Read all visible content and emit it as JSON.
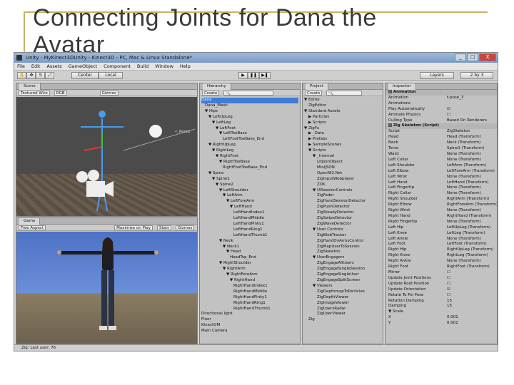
{
  "slide": {
    "title": "Connecting Joints for Dana the Avatar"
  },
  "window": {
    "title": "Unity - MyKinect3DUnity - Kinect3D - PC, Mac & Linux Standalone*",
    "buttons": [
      "_",
      "□",
      "X"
    ]
  },
  "menu": [
    "File",
    "Edit",
    "Assets",
    "GameObject",
    "Component",
    "Build",
    "Window",
    "Help"
  ],
  "toolbar": {
    "pivot": "Center",
    "space": "Local",
    "layers": "Layers",
    "layout": "2 by 3"
  },
  "scene": {
    "tab": "Scene",
    "mode": "Textured Wire",
    "render": "RGB",
    "gizmos": "Gizmos",
    "persp": "< Persp"
  },
  "game": {
    "tab": "Game",
    "aspect": "Free Aspect",
    "maximize": "Maximize on Play",
    "stats": "Stats",
    "gizmos": "Gizmos"
  },
  "hierarchy": {
    "tab": "Hierarchy",
    "create": "Create",
    "items": [
      {
        "label": "Dana",
        "depth": 0,
        "selected": true
      },
      {
        "label": "Dana_Mesh",
        "depth": 1
      },
      {
        "label": "▼ Hips",
        "depth": 1
      },
      {
        "label": "▼ LeftUpLeg",
        "depth": 2
      },
      {
        "label": "▼ LeftLeg",
        "depth": 3
      },
      {
        "label": "▼ LeftFoot",
        "depth": 4
      },
      {
        "label": "▼ LeftToeBase",
        "depth": 5
      },
      {
        "label": "LeftFootToeBase_End",
        "depth": 6
      },
      {
        "label": "▼ RightUpLeg",
        "depth": 2
      },
      {
        "label": "▼ RightLeg",
        "depth": 3
      },
      {
        "label": "▼ RightFoot",
        "depth": 4
      },
      {
        "label": "▼ RightToeBase",
        "depth": 5
      },
      {
        "label": "RightFootToeBase_End",
        "depth": 6
      },
      {
        "label": "▼ Spine",
        "depth": 2
      },
      {
        "label": "▼ Spine1",
        "depth": 3
      },
      {
        "label": "▼ Spine2",
        "depth": 4
      },
      {
        "label": "▼ LeftShoulder",
        "depth": 5
      },
      {
        "label": "▼ LeftArm",
        "depth": 6
      },
      {
        "label": "▼ LeftForeArm",
        "depth": 7
      },
      {
        "label": "▼ LeftHand",
        "depth": 8
      },
      {
        "label": "LeftHandIndex1",
        "depth": 9
      },
      {
        "label": "LeftHandMiddle",
        "depth": 9
      },
      {
        "label": "LeftHandPinky1",
        "depth": 9
      },
      {
        "label": "LeftHandRing1",
        "depth": 9
      },
      {
        "label": "LeftHandThumb1",
        "depth": 9
      },
      {
        "label": "▼ Neck",
        "depth": 5
      },
      {
        "label": "▼ Neck1",
        "depth": 6
      },
      {
        "label": "▼ Head",
        "depth": 7
      },
      {
        "label": "HeadTop_End",
        "depth": 8
      },
      {
        "label": "▼ RightShoulder",
        "depth": 5
      },
      {
        "label": "▼ RightArm",
        "depth": 6
      },
      {
        "label": "▼ RightForeArm",
        "depth": 7
      },
      {
        "label": "▼ RightHand",
        "depth": 8
      },
      {
        "label": "RightHandIndex1",
        "depth": 9
      },
      {
        "label": "RightHandMiddle",
        "depth": 9
      },
      {
        "label": "RightHandPinky1",
        "depth": 9
      },
      {
        "label": "RightHandRing1",
        "depth": 9
      },
      {
        "label": "RightHandThumb1",
        "depth": 9
      },
      {
        "label": "Directional light",
        "depth": 0
      },
      {
        "label": "Floor",
        "depth": 0
      },
      {
        "label": "KinectOM",
        "depth": 0
      },
      {
        "label": "Main Camera",
        "depth": 0
      }
    ]
  },
  "project": {
    "tab": "Project",
    "create": "Create",
    "items": [
      {
        "label": "▼ Editor",
        "depth": 0
      },
      {
        "label": "ZigEditor",
        "depth": 1
      },
      {
        "label": "▼ Standard Assets",
        "depth": 0
      },
      {
        "label": "▶ Particles",
        "depth": 1
      },
      {
        "label": "▶ Scripts",
        "depth": 1
      },
      {
        "label": "▼ ZigFu",
        "depth": 0
      },
      {
        "label": "▶ _Data",
        "depth": 1
      },
      {
        "label": "▶ Prefabs",
        "depth": 1
      },
      {
        "label": "▶ SampleScenes",
        "depth": 1
      },
      {
        "label": "▼ Scripts",
        "depth": 1
      },
      {
        "label": "▼ _Internal",
        "depth": 2
      },
      {
        "label": "LitJsonObject",
        "depth": 3
      },
      {
        "label": "MiniJSON",
        "depth": 3
      },
      {
        "label": "OpenNI2.Net",
        "depth": 3
      },
      {
        "label": "ZigInputWebplayer",
        "depth": 3
      },
      {
        "label": "ZDK",
        "depth": 3
      },
      {
        "label": "▼ UISessionControls",
        "depth": 2
      },
      {
        "label": "ZigFader",
        "depth": 3
      },
      {
        "label": "ZigHandSessionDetector",
        "depth": 3
      },
      {
        "label": "ZigPushDetector",
        "depth": 3
      },
      {
        "label": "ZigSteadyDetector",
        "depth": 3
      },
      {
        "label": "ZigSwipeDetector",
        "depth": 3
      },
      {
        "label": "ZigWaveDetector",
        "depth": 3
      },
      {
        "label": "▼ User Controls",
        "depth": 2
      },
      {
        "label": "ZigBlobTracker",
        "depth": 3
      },
      {
        "label": "ZigHandOnArmsControl",
        "depth": 3
      },
      {
        "label": "ZigMapUserToSession",
        "depth": 3
      },
      {
        "label": "ZigSkeleton",
        "depth": 3
      },
      {
        "label": "▼ UserEngagers",
        "depth": 2
      },
      {
        "label": "ZigEngageAllUsers",
        "depth": 3
      },
      {
        "label": "ZigEngageSingleSession",
        "depth": 3
      },
      {
        "label": "ZigEngageSingleUser",
        "depth": 3
      },
      {
        "label": "ZigEngageSplitScreen",
        "depth": 3
      },
      {
        "label": "▼ Viewers",
        "depth": 2
      },
      {
        "label": "ZigDepthmapToParticles",
        "depth": 3
      },
      {
        "label": "ZigDepthViewer",
        "depth": 3
      },
      {
        "label": "ZigImageViewer",
        "depth": 3
      },
      {
        "label": "ZigUsersRadar",
        "depth": 3
      },
      {
        "label": "ZigUserViewer",
        "depth": 3
      },
      {
        "label": "Zig",
        "depth": 1
      }
    ]
  },
  "inspector": {
    "tab": "Inspector",
    "animation": {
      "header": "Animation",
      "rows": [
        {
          "k": "Animation",
          "v": "t-pose_3"
        },
        {
          "k": "Animations",
          "v": ""
        },
        {
          "k": "Play Automatically",
          "v": "☑"
        },
        {
          "k": "Animate Physics",
          "v": "☐"
        },
        {
          "k": "Culling Type",
          "v": "Based On Renderers"
        }
      ]
    },
    "skeleton": {
      "header": "Zig Skeleton (Script)",
      "rows": [
        {
          "k": "Script",
          "v": "ZigSkeleton"
        },
        {
          "k": "Head",
          "v": "Head (Transform)"
        },
        {
          "k": "Neck",
          "v": "Neck (Transform)"
        },
        {
          "k": "Torso",
          "v": "Spine1 (Transform)"
        },
        {
          "k": "Waist",
          "v": "None (Transform)"
        },
        {
          "k": "Left Collar",
          "v": "None (Transform)"
        },
        {
          "k": "Left Shoulder",
          "v": "LeftArm (Transform)"
        },
        {
          "k": "Left Elbow",
          "v": "LeftForeArm (Transform)"
        },
        {
          "k": "Left Wrist",
          "v": "None (Transform)"
        },
        {
          "k": "Left Hand",
          "v": "LeftHand (Transform)"
        },
        {
          "k": "Left Fingertip",
          "v": "None (Transform)"
        },
        {
          "k": "Right Collar",
          "v": "None (Transform)"
        },
        {
          "k": "Right Shoulder",
          "v": "RightArm (Transform)"
        },
        {
          "k": "Right Elbow",
          "v": "RightForeArm (Transform)"
        },
        {
          "k": "Right Wrist",
          "v": "None (Transform)"
        },
        {
          "k": "Right Hand",
          "v": "RightHand (Transform)"
        },
        {
          "k": "Right Fingertip",
          "v": "None (Transform)"
        },
        {
          "k": "Left Hip",
          "v": "LeftUpLeg (Transform)"
        },
        {
          "k": "Left Knee",
          "v": "LeftLeg (Transform)"
        },
        {
          "k": "Left Ankle",
          "v": "None (Transform)"
        },
        {
          "k": "Left Foot",
          "v": "LeftFoot (Transform)"
        },
        {
          "k": "Right Hip",
          "v": "RightUpLeg (Transform)"
        },
        {
          "k": "Right Knee",
          "v": "RightLeg (Transform)"
        },
        {
          "k": "Right Ankle",
          "v": "None (Transform)"
        },
        {
          "k": "Right Foot",
          "v": "RightFoot (Transform)"
        },
        {
          "k": "Mirror",
          "v": "☐"
        },
        {
          "k": "Update Joint Positions",
          "v": "☐"
        },
        {
          "k": "Update Root Position",
          "v": "☐"
        },
        {
          "k": "Update Orientation",
          "v": "☑"
        },
        {
          "k": "Rotate To Psi Pose",
          "v": "☐"
        },
        {
          "k": "Rotation Damping",
          "v": "15"
        },
        {
          "k": "Damping",
          "v": "15"
        },
        {
          "k": "▼ Scale",
          "v": ""
        },
        {
          "k": "X",
          "v": "0.001"
        },
        {
          "k": "Y",
          "v": "0.001"
        }
      ]
    }
  },
  "status": {
    "text": "Zig: Last user: 76"
  }
}
